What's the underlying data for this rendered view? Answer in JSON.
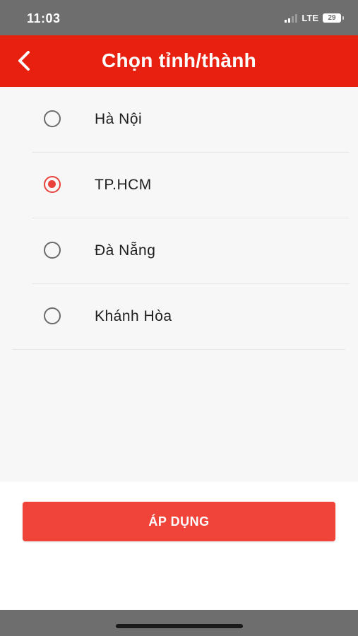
{
  "status_bar": {
    "time": "11:03",
    "network": "LTE",
    "battery": "29"
  },
  "header": {
    "title": "Chọn tỉnh/thành",
    "back_icon": "chevron-left-icon",
    "background_color": "#e8200f"
  },
  "provinces": [
    {
      "label": "Hà Nội",
      "selected": false
    },
    {
      "label": "TP.HCM",
      "selected": true
    },
    {
      "label": "Đà Nẵng",
      "selected": false
    },
    {
      "label": "Khánh Hòa",
      "selected": false
    }
  ],
  "apply_button": {
    "label": "ÁP DỤNG",
    "color": "#f0433a"
  },
  "accent_color": "#e8423a"
}
